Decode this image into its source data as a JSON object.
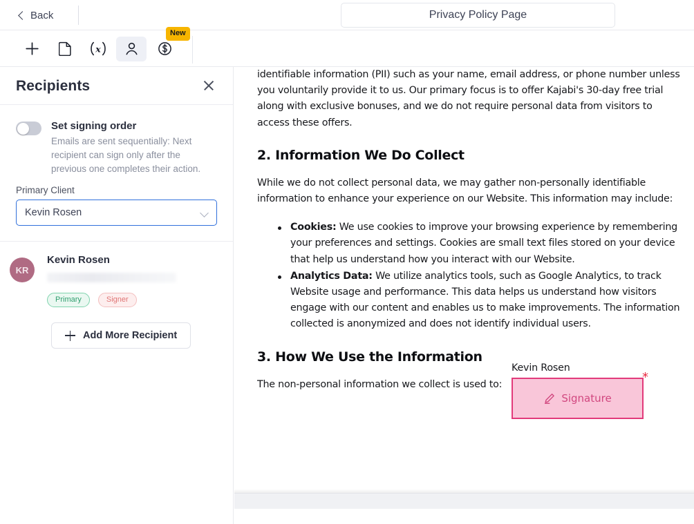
{
  "topbar": {
    "back_label": "Back",
    "document_title": "Privacy Policy Page"
  },
  "toolbar": {
    "tools": [
      {
        "name": "add-tool",
        "icon": "plus-icon",
        "label": ""
      },
      {
        "name": "document-tool",
        "icon": "document-icon",
        "label": ""
      },
      {
        "name": "variable-tool",
        "icon": "variable-x-icon",
        "label": "(x)"
      },
      {
        "name": "recipients-tool",
        "icon": "person-icon",
        "label": ""
      },
      {
        "name": "payment-tool",
        "icon": "dollar-circle-icon",
        "label": ""
      }
    ],
    "new_badge": "New"
  },
  "panel": {
    "title": "Recipients",
    "close_label": "",
    "signing_order": {
      "title": "Set signing order",
      "description": "Emails are sent sequentially: Next recipient can sign only after the previous one completes their action.",
      "enabled": false
    },
    "primary_client": {
      "label": "Primary Client",
      "value": "Kevin Rosen"
    },
    "recipient": {
      "initials": "KR",
      "name": "Kevin Rosen",
      "email_hidden": true,
      "badges": [
        "Primary",
        "Signer"
      ]
    },
    "add_more_label": "Add More Recipient"
  },
  "document": {
    "paragraph_1": "identifiable information (PII) such as your name, email address, or phone number unless you voluntarily provide it to us. Our primary focus is to offer Kajabi's 30-day free trial along with exclusive bonuses, and we do not require personal data from visitors to access these offers.",
    "heading_2": "2. Information We Do Collect",
    "paragraph_2": "While we do not collect personal data, we may gather non-personally identifiable information to enhance your experience on our Website. This information may include:",
    "bullets": [
      {
        "term": "Cookies:",
        "text": " We use cookies to improve your browsing experience by remembering your preferences and settings. Cookies are small text files stored on your device that help us understand how you interact with our Website."
      },
      {
        "term": "Analytics Data:",
        "text": " We utilize analytics tools, such as Google Analytics, to track Website usage and performance. This data helps us understand how visitors engage with our content and enables us to make improvements. The information collected is anonymized and does not identify individual users."
      }
    ],
    "heading_3": "3. How We Use the Information",
    "paragraph_3": "The non-personal information we collect is used to:",
    "signature_field": {
      "recipient_name": "Kevin Rosen",
      "label": "Signature",
      "required_marker": "*",
      "icon": "pen-icon"
    }
  },
  "colors": {
    "accent_blue": "#2f6fdb",
    "badge_primary": "#2f9e6e",
    "badge_signer": "#e07575",
    "signature_border": "#e23a7a",
    "signature_fill": "#f9c6d9",
    "signature_text": "#d1477f",
    "new_badge": "#f7b500",
    "avatar": "#b06b83"
  }
}
